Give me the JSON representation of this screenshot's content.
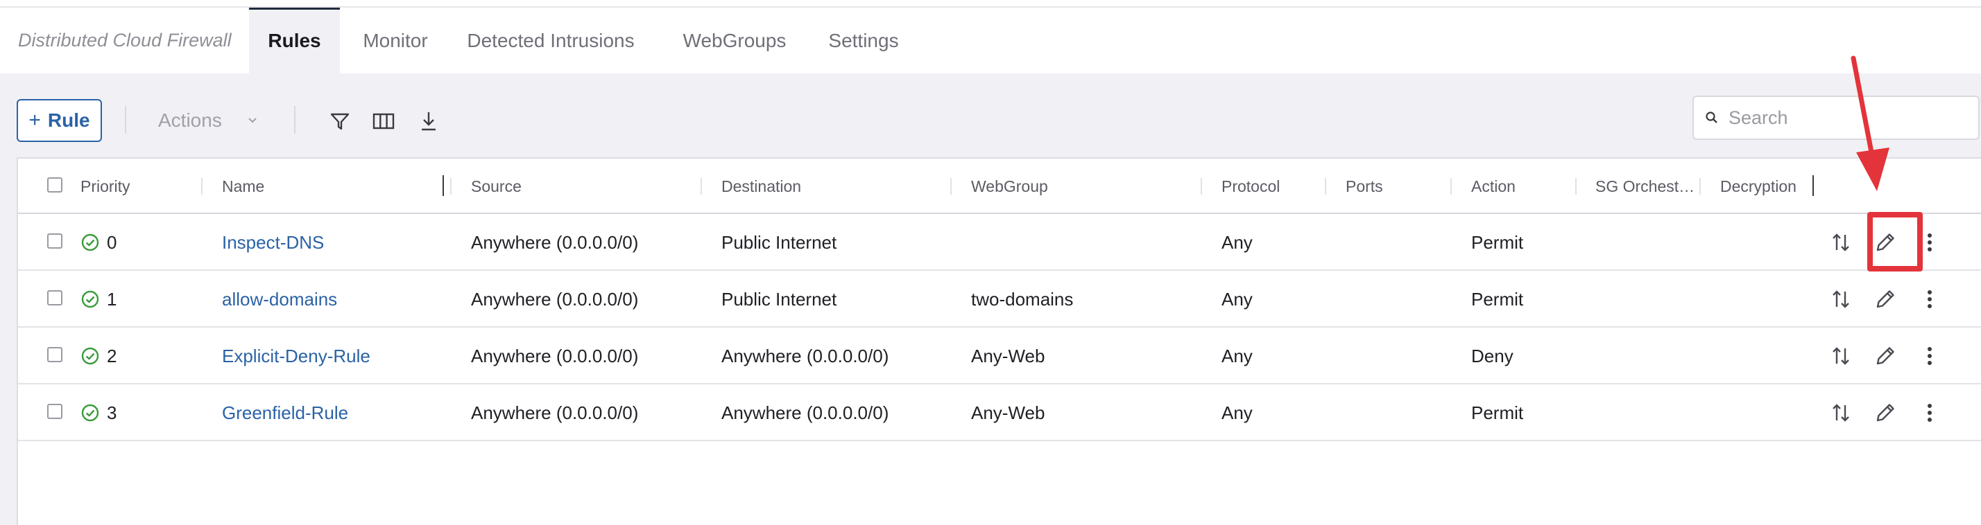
{
  "tabs": {
    "brand": "Distributed Cloud Firewall",
    "items": [
      {
        "label": "Rules",
        "active": true
      },
      {
        "label": "Monitor",
        "active": false
      },
      {
        "label": "Detected Intrusions",
        "active": false
      },
      {
        "label": "WebGroups",
        "active": false
      },
      {
        "label": "Settings",
        "active": false
      }
    ]
  },
  "toolbar": {
    "add_rule_label": "Rule",
    "actions_label": "Actions",
    "search_placeholder": "Search"
  },
  "table": {
    "columns": [
      "Priority",
      "Name",
      "Source",
      "Destination",
      "WebGroup",
      "Protocol",
      "Ports",
      "Action",
      "SG Orchest…",
      "Decryption"
    ],
    "rows": [
      {
        "priority": "0",
        "name": "Inspect-DNS",
        "source": "Anywhere (0.0.0.0/0)",
        "destination": "Public Internet",
        "webgroup": "",
        "protocol": "Any",
        "ports": "",
        "action": "Permit",
        "sg": "",
        "decryption": ""
      },
      {
        "priority": "1",
        "name": "allow-domains",
        "source": "Anywhere (0.0.0.0/0)",
        "destination": "Public Internet",
        "webgroup": "two-domains",
        "protocol": "Any",
        "ports": "",
        "action": "Permit",
        "sg": "",
        "decryption": ""
      },
      {
        "priority": "2",
        "name": "Explicit-Deny-Rule",
        "source": "Anywhere (0.0.0.0/0)",
        "destination": "Anywhere (0.0.0.0/0)",
        "webgroup": "Any-Web",
        "protocol": "Any",
        "ports": "",
        "action": "Deny",
        "sg": "",
        "decryption": ""
      },
      {
        "priority": "3",
        "name": "Greenfield-Rule",
        "source": "Anywhere (0.0.0.0/0)",
        "destination": "Anywhere (0.0.0.0/0)",
        "webgroup": "Any-Web",
        "protocol": "Any",
        "ports": "",
        "action": "Permit",
        "sg": "",
        "decryption": ""
      }
    ]
  },
  "colors": {
    "accent": "#2a62a6",
    "status_ok": "#3a9a3a",
    "annotation": "#e3343b"
  }
}
